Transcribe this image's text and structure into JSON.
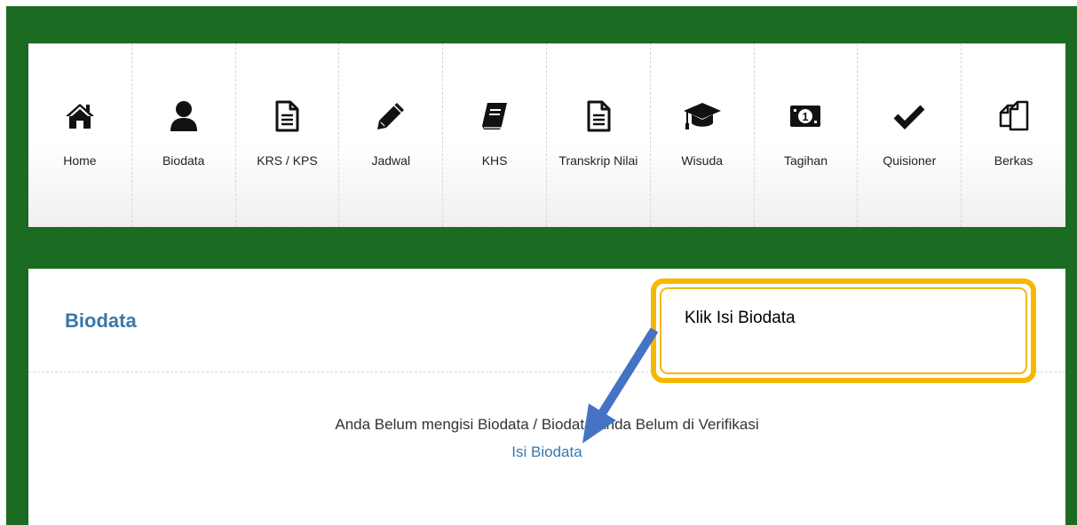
{
  "nav": {
    "items": [
      {
        "label": "Home",
        "icon": "home-icon"
      },
      {
        "label": "Biodata",
        "icon": "user-icon"
      },
      {
        "label": "KRS / KPS",
        "icon": "document-icon"
      },
      {
        "label": "Jadwal",
        "icon": "pencil-icon"
      },
      {
        "label": "KHS",
        "icon": "book-icon"
      },
      {
        "label": "Transkrip Nilai",
        "icon": "document-icon"
      },
      {
        "label": "Wisuda",
        "icon": "graduation-cap-icon"
      },
      {
        "label": "Tagihan",
        "icon": "money-icon"
      },
      {
        "label": "Quisioner",
        "icon": "checkmark-icon"
      },
      {
        "label": "Berkas",
        "icon": "copy-files-icon"
      }
    ]
  },
  "content": {
    "title": "Biodata",
    "message": "Anda Belum mengisi Biodata / Biodata Anda Belum di Verifikasi",
    "link_label": "Isi Biodata"
  },
  "callout": {
    "text": "Klik Isi Biodata"
  },
  "colors": {
    "frame_green": "#1c6b22",
    "title_blue": "#3a78a8",
    "callout_border": "#f5b800",
    "arrow_blue": "#4472c4"
  }
}
